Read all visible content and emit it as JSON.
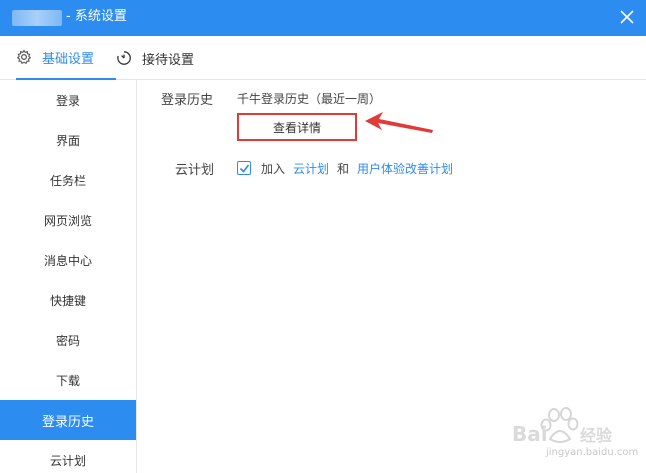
{
  "window": {
    "title": "- 系统设置",
    "close_icon": "close-icon"
  },
  "tabs": [
    {
      "label": "基础设置",
      "icon": "gear-icon",
      "active": true
    },
    {
      "label": "接待设置",
      "icon": "clock-icon",
      "active": false
    }
  ],
  "sidebar": {
    "items": [
      {
        "label": "登录"
      },
      {
        "label": "界面"
      },
      {
        "label": "任务栏"
      },
      {
        "label": "网页浏览"
      },
      {
        "label": "消息中心"
      },
      {
        "label": "快捷键"
      },
      {
        "label": "密码"
      },
      {
        "label": "下载"
      },
      {
        "label": "登录历史",
        "active": true
      },
      {
        "label": "云计划"
      }
    ]
  },
  "main": {
    "login_history": {
      "label": "登录历史",
      "description": "千牛登录历史（最近一周）",
      "button": "查看详情"
    },
    "cloud_plan": {
      "label": "云计划",
      "checked": true,
      "prefix": "加入",
      "link1": "云计划",
      "conj": "和",
      "link2": "用户体验改善计划"
    }
  },
  "watermark": {
    "brand": "Bai du 经验",
    "url": "jingyan.baidu.com"
  },
  "colors": {
    "accent": "#2d8cf0",
    "highlight_red": "#e23a36"
  }
}
